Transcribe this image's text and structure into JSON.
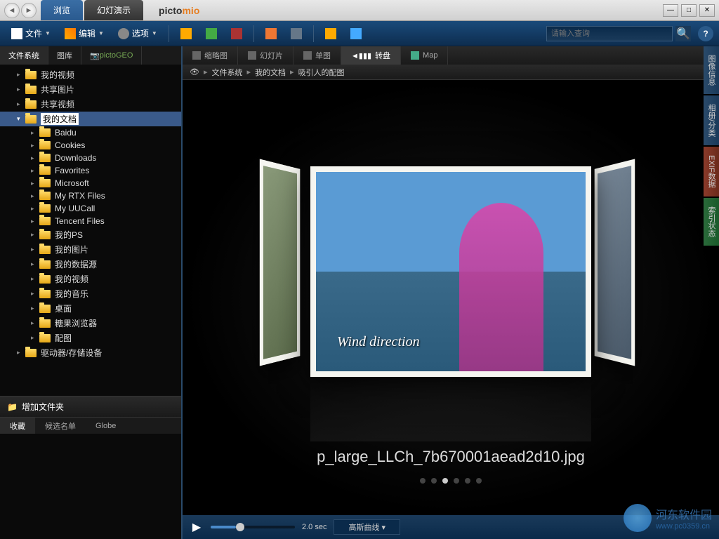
{
  "titlebar": {
    "tabs": [
      "浏览",
      "幻灯演示"
    ],
    "logo_prefix": "picto",
    "logo_suffix": "mio"
  },
  "win_controls": {
    "min": "—",
    "max": "□",
    "close": "✕"
  },
  "toolbar": {
    "file": "文件",
    "edit": "编辑",
    "options": "选项",
    "search_placeholder": "请输入查询"
  },
  "sidebar": {
    "tabs": [
      "文件系统",
      "图库",
      "pictoGEO"
    ],
    "tree": [
      {
        "label": "我的视频",
        "indent": 1,
        "expanded": false
      },
      {
        "label": "共享图片",
        "indent": 1,
        "expanded": false
      },
      {
        "label": "共享视频",
        "indent": 1,
        "expanded": false
      },
      {
        "label": "我的文档",
        "indent": 1,
        "expanded": true,
        "selected": true
      },
      {
        "label": "Baidu",
        "indent": 2,
        "expanded": false
      },
      {
        "label": "Cookies",
        "indent": 2,
        "expanded": false
      },
      {
        "label": "Downloads",
        "indent": 2,
        "expanded": false
      },
      {
        "label": "Favorites",
        "indent": 2,
        "expanded": false
      },
      {
        "label": "Microsoft",
        "indent": 2,
        "expanded": false
      },
      {
        "label": "My RTX Files",
        "indent": 2,
        "expanded": false
      },
      {
        "label": "My UUCall",
        "indent": 2,
        "expanded": false
      },
      {
        "label": "Tencent Files",
        "indent": 2,
        "expanded": false
      },
      {
        "label": "我的PS",
        "indent": 2,
        "expanded": false
      },
      {
        "label": "我的图片",
        "indent": 2,
        "expanded": false
      },
      {
        "label": "我的数据源",
        "indent": 2,
        "expanded": false
      },
      {
        "label": "我的视频",
        "indent": 2,
        "expanded": false
      },
      {
        "label": "我的音乐",
        "indent": 2,
        "expanded": false
      },
      {
        "label": "桌面",
        "indent": 2,
        "expanded": false
      },
      {
        "label": "糖果浏览器",
        "indent": 2,
        "expanded": false
      },
      {
        "label": "配图",
        "indent": 2,
        "expanded": false
      },
      {
        "label": "驱动器/存储设备",
        "indent": 1,
        "expanded": false
      }
    ],
    "add_folder": "增加文件夹",
    "bottom_tabs": [
      "收藏",
      "候选名单",
      "Globe"
    ]
  },
  "content": {
    "view_tabs": [
      "缩略图",
      "幻灯片",
      "单图",
      "转盘",
      "Map"
    ],
    "breadcrumb": [
      "文件系统",
      "我的文档",
      "吸引人的配图"
    ],
    "photo_caption": "Wind direction",
    "filename": "p_large_LLCh_7b670001aead2d10.jpg",
    "player": {
      "time": "2.0 sec",
      "effect": "高斯曲线"
    }
  },
  "right_panels": [
    "图像信息",
    "相册/分类",
    "EXIF数据",
    "索引状态"
  ],
  "watermark": {
    "name": "河东软件园",
    "url": "www.pc0359.cn"
  }
}
